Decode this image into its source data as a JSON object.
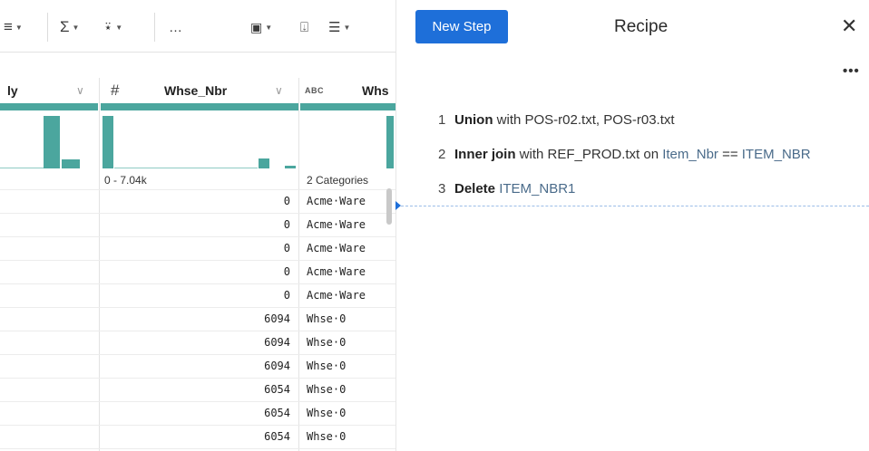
{
  "toolbar": {
    "more_label": "…"
  },
  "columns": [
    {
      "name": "ly",
      "type": ""
    },
    {
      "name": "Whse_Nbr",
      "type": "#"
    },
    {
      "name": "Whs",
      "type": "ABC"
    }
  ],
  "whse_nbr_summary": "0 - 7.04k",
  "whse_summary": "2 Categories",
  "rows": [
    {
      "whse_nbr": "0",
      "whse": "Acme·Ware"
    },
    {
      "whse_nbr": "0",
      "whse": "Acme·Ware"
    },
    {
      "whse_nbr": "0",
      "whse": "Acme·Ware"
    },
    {
      "whse_nbr": "0",
      "whse": "Acme·Ware"
    },
    {
      "whse_nbr": "0",
      "whse": "Acme·Ware"
    },
    {
      "whse_nbr": "6094",
      "whse": "Whse·0"
    },
    {
      "whse_nbr": "6094",
      "whse": "Whse·0"
    },
    {
      "whse_nbr": "6094",
      "whse": "Whse·0"
    },
    {
      "whse_nbr": "6054",
      "whse": "Whse·0"
    },
    {
      "whse_nbr": "6054",
      "whse": "Whse·0"
    },
    {
      "whse_nbr": "6054",
      "whse": "Whse·0"
    }
  ],
  "recipe": {
    "new_step_label": "New Step",
    "title": "Recipe",
    "close_glyph": "✕",
    "more_glyph": "•••",
    "steps": [
      {
        "num": "1",
        "keyword": "Union",
        "text": " with POS-r02.txt, POS-r03.txt",
        "col_a": "",
        "mid": "",
        "col_b": ""
      },
      {
        "num": "2",
        "keyword": "Inner join",
        "text": " with REF_PROD.txt on ",
        "col_a": "Item_Nbr",
        "mid": " == ",
        "col_b": "ITEM_NBR"
      },
      {
        "num": "3",
        "keyword": "Delete",
        "text": " ",
        "col_a": "ITEM_NBR1",
        "mid": "",
        "col_b": ""
      }
    ]
  },
  "colors": {
    "accent": "#1e6fd9",
    "histogram": "#4ba69e"
  }
}
